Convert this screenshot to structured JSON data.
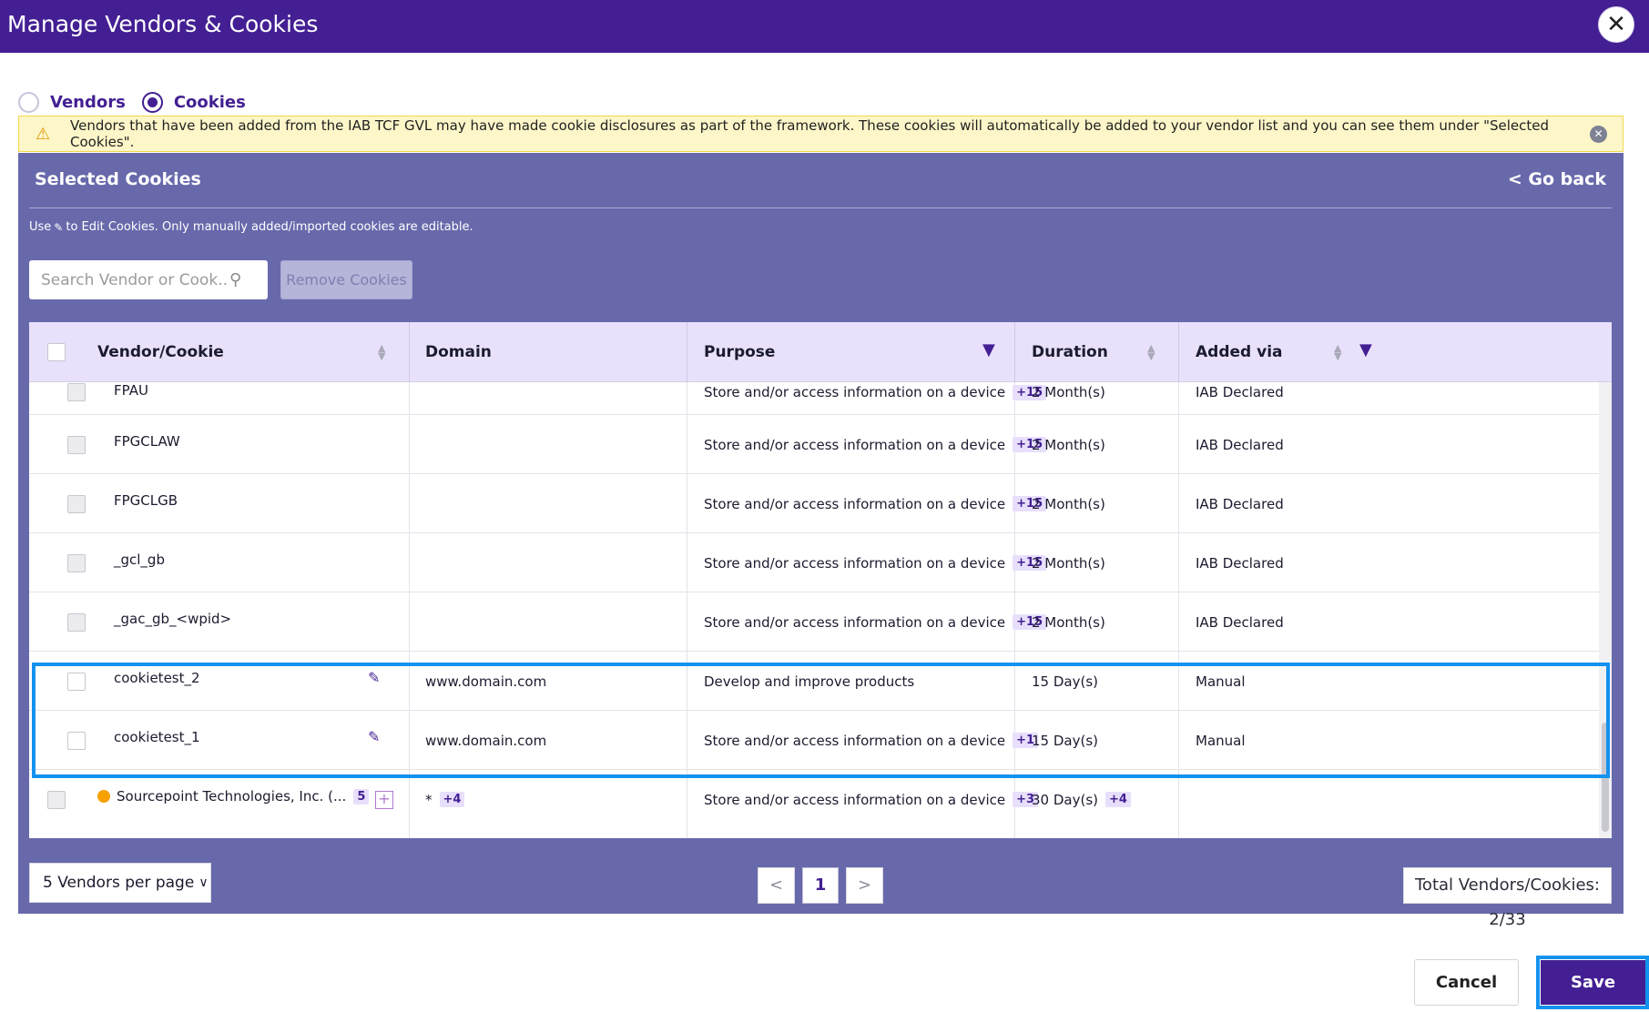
{
  "header": {
    "title": "Manage Vendors & Cookies",
    "close_icon": "close-icon",
    "close_glyph": "✕"
  },
  "mode_toggle": {
    "options": [
      {
        "label": "Vendors",
        "selected": false
      },
      {
        "label": "Cookies",
        "selected": true
      }
    ]
  },
  "alert": {
    "icon": "warning-icon",
    "text": "Vendors that have been added from the IAB TCF GVL may have made cookie disclosures as part of the framework. These cookies will automatically be added to your vendor list and you can see them under \"Selected Cookies\".",
    "dismiss_icon": "close-circle-icon"
  },
  "panel": {
    "title": "Selected Cookies",
    "go_back": "< Go back",
    "hint_prefix": "Use",
    "hint_suffix": "to Edit Cookies. Only manually added/imported cookies are editable."
  },
  "search": {
    "placeholder": "Search Vendor or Cook...",
    "value": ""
  },
  "remove_button": "Remove Cookies",
  "table": {
    "columns": [
      {
        "label": "Vendor/Cookie",
        "sortable": true,
        "filter": false
      },
      {
        "label": "Domain",
        "sortable": false,
        "filter": false
      },
      {
        "label": "Purpose",
        "sortable": false,
        "filter": true
      },
      {
        "label": "Duration",
        "sortable": true,
        "filter": false
      },
      {
        "label": "Added via",
        "sortable": true,
        "filter": true
      }
    ],
    "rows": [
      {
        "name": "FPAU",
        "domain": "",
        "purpose": "Store and/or access information on a device",
        "purpose_tag": "+15",
        "duration": "2 Month(s)",
        "duration_tag": "",
        "added_via": "IAB Declared",
        "editable": false
      },
      {
        "name": "FPGCLAW",
        "domain": "",
        "purpose": "Store and/or access information on a device",
        "purpose_tag": "+15",
        "duration": "2 Month(s)",
        "duration_tag": "",
        "added_via": "IAB Declared",
        "editable": false
      },
      {
        "name": "FPGCLGB",
        "domain": "",
        "purpose": "Store and/or access information on a device",
        "purpose_tag": "+15",
        "duration": "2 Month(s)",
        "duration_tag": "",
        "added_via": "IAB Declared",
        "editable": false
      },
      {
        "name": "_gcl_gb",
        "domain": "",
        "purpose": "Store and/or access information on a device",
        "purpose_tag": "+15",
        "duration": "2 Month(s)",
        "duration_tag": "",
        "added_via": "IAB Declared",
        "editable": false
      },
      {
        "name": "_gac_gb_<wpid>",
        "domain": "",
        "purpose": "Store and/or access information on a device",
        "purpose_tag": "+15",
        "duration": "2 Month(s)",
        "duration_tag": "",
        "added_via": "IAB Declared",
        "editable": false
      },
      {
        "name": "cookietest_2",
        "domain": "www.domain.com",
        "purpose": "Develop and improve products",
        "purpose_tag": "",
        "duration": "15 Day(s)",
        "duration_tag": "",
        "added_via": "Manual",
        "editable": true
      },
      {
        "name": "cookietest_1",
        "domain": "www.domain.com",
        "purpose": "Store and/or access information on a device",
        "purpose_tag": "+1",
        "duration": "15 Day(s)",
        "duration_tag": "",
        "added_via": "Manual",
        "editable": true
      }
    ],
    "vendor_row": {
      "name": "Sourcepoint Technologies, Inc. (...",
      "count": "5",
      "status_color": "#f5a100",
      "domain": "*",
      "domain_tag": "+4",
      "purpose": "Store and/or access information on a device",
      "purpose_tag": "+3",
      "duration": "30 Day(s)",
      "duration_tag": "+4",
      "added_via": ""
    }
  },
  "pagination": {
    "per_page": "5 Vendors per page",
    "prev_glyph": "<",
    "current_page": "1",
    "next_glyph": ">",
    "total": "Total Vendors/Cookies: 2/33"
  },
  "footer": {
    "cancel": "Cancel",
    "save": "Save"
  },
  "colors": {
    "brand": "#431f93",
    "panel": "#6869ab",
    "highlight": "#1492ef",
    "header_row": "#e9e1fb"
  }
}
